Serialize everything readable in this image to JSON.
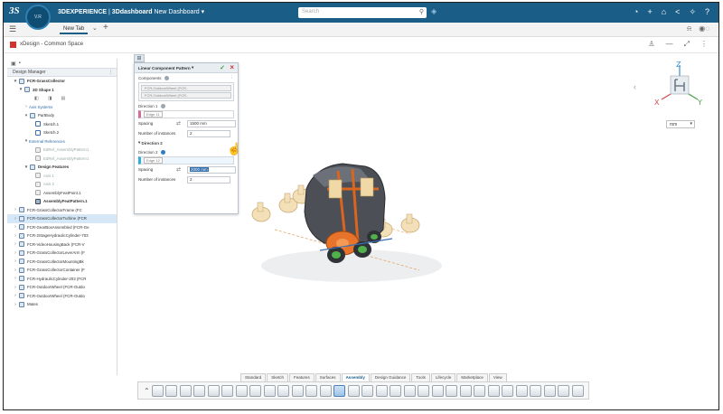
{
  "topbar": {
    "brand": "3DEXPERIENCE",
    "separator": " | ",
    "app": "3Ddashboard",
    "dashboard": "New Dashboard",
    "search_placeholder": "Search",
    "compass_label": "V.R"
  },
  "tabs": {
    "active": "New Tab"
  },
  "app_header": {
    "title": "xDesign - Common Space"
  },
  "tree": {
    "manager_label": "Design Manager",
    "rows": [
      {
        "label": "FCR-GrassCollector",
        "indent": 1,
        "exp": "▾",
        "icon": "asm",
        "style": "bold"
      },
      {
        "label": "3D Shape 1",
        "indent": 2,
        "exp": "▾",
        "icon": "asm",
        "style": "bold"
      },
      {
        "label": "",
        "indent": 0,
        "exp": "",
        "icon": "mini",
        "style": ""
      },
      {
        "label": "Axis Systems",
        "indent": 3,
        "exp": "›",
        "icon": "",
        "style": "blue"
      },
      {
        "label": "PartBody",
        "indent": 3,
        "exp": "▾",
        "icon": "asm",
        "style": ""
      },
      {
        "label": "Sketch.1",
        "indent": 4,
        "exp": "",
        "icon": "sk",
        "style": ""
      },
      {
        "label": "Sketch.2",
        "indent": 4,
        "exp": "",
        "icon": "sk",
        "style": ""
      },
      {
        "label": "External References",
        "indent": 3,
        "exp": "▾",
        "icon": "",
        "style": "blue"
      },
      {
        "label": "EdRef_AssemblyPattern1",
        "indent": 4,
        "exp": "",
        "icon": "gray",
        "style": "dim"
      },
      {
        "label": "EdRef_AssemblyPattern1",
        "indent": 4,
        "exp": "",
        "icon": "gray",
        "style": "dim"
      },
      {
        "label": "Design Features",
        "indent": 3,
        "exp": "▾",
        "icon": "asm",
        "style": "bold"
      },
      {
        "label": "Axis 1",
        "indent": 4,
        "exp": "",
        "icon": "gray",
        "style": "dim"
      },
      {
        "label": "Axis 2",
        "indent": 4,
        "exp": "",
        "icon": "gray",
        "style": "dim"
      },
      {
        "label": "AssemblyFeatPoint.1",
        "indent": 4,
        "exp": "",
        "icon": "gray",
        "style": ""
      },
      {
        "label": "AssemblyFeatPattern.1",
        "indent": 4,
        "exp": "",
        "icon": "pat",
        "style": "bold"
      },
      {
        "label": "FCR-GrassCollectorFrame (FC",
        "indent": 1,
        "exp": "›",
        "icon": "asm",
        "style": ""
      },
      {
        "label": "FCR-GrassCollectorTurbine (FCR",
        "indent": 1,
        "exp": "›",
        "icon": "asm",
        "style": "sel"
      },
      {
        "label": "FCR-GearBoxAssembled (FCR-Ge",
        "indent": 1,
        "exp": "›",
        "icon": "asm",
        "style": ""
      },
      {
        "label": "FCR-2StageHydraulicCylinder-703",
        "indent": 1,
        "exp": "›",
        "icon": "asm",
        "style": ""
      },
      {
        "label": "FCR-VideoHousingBack (FCR-V",
        "indent": 1,
        "exp": "›",
        "icon": "asm",
        "style": ""
      },
      {
        "label": "FCR-GrassCollectorLeverArm (F",
        "indent": 1,
        "exp": "›",
        "icon": "asm",
        "style": ""
      },
      {
        "label": "FCR-GrassCollectorMountingBk",
        "indent": 1,
        "exp": "›",
        "icon": "asm",
        "style": ""
      },
      {
        "label": "FCR-GrassCollectorContainer (F",
        "indent": 1,
        "exp": "›",
        "icon": "asm",
        "style": ""
      },
      {
        "label": "FCR-HydraulicCylinder-203 (FCR",
        "indent": 1,
        "exp": "›",
        "icon": "asm",
        "style": ""
      },
      {
        "label": "FCR-OutdoorWheel (FCR-Outdo",
        "indent": 1,
        "exp": "›",
        "icon": "asm",
        "style": ""
      },
      {
        "label": "FCR-OutdoorWheel (FCR-Outdo",
        "indent": 1,
        "exp": "›",
        "icon": "asm",
        "style": ""
      },
      {
        "label": "Mates",
        "indent": 1,
        "exp": "›",
        "icon": "asm",
        "style": ""
      }
    ]
  },
  "dialog": {
    "title": "Linear Component Pattern",
    "components_label": "Components",
    "components": [
      "FCR-OutdoorWheel (FCR-",
      "FCR-OutdoorWheel (FCR-"
    ],
    "direction1_label": "Direction 1",
    "direction1_edge": "Edge 11",
    "spacing_label": "Spacing",
    "spacing1_value": "1500 mm",
    "instances_label": "Number of instances",
    "instances1_value": "2",
    "direction2_header": "Direction 2",
    "direction2_label": "Direction 2",
    "direction2_edge": "Edge 12",
    "spacing2_value": "2000 mm",
    "instances2_value": "2"
  },
  "viewport": {
    "units": "mm",
    "axis_x": "X",
    "axis_y": "Y",
    "axis_z": "Z"
  },
  "toolbar": {
    "tabs": [
      "Standard",
      "Sketch",
      "Features",
      "Surfaces",
      "Assembly",
      "Design Guidance",
      "Tools",
      "Lifecycle",
      "Marketplace",
      "View"
    ],
    "active_tab": "Assembly",
    "tool_count": 31,
    "selected_tool_index": 13
  }
}
